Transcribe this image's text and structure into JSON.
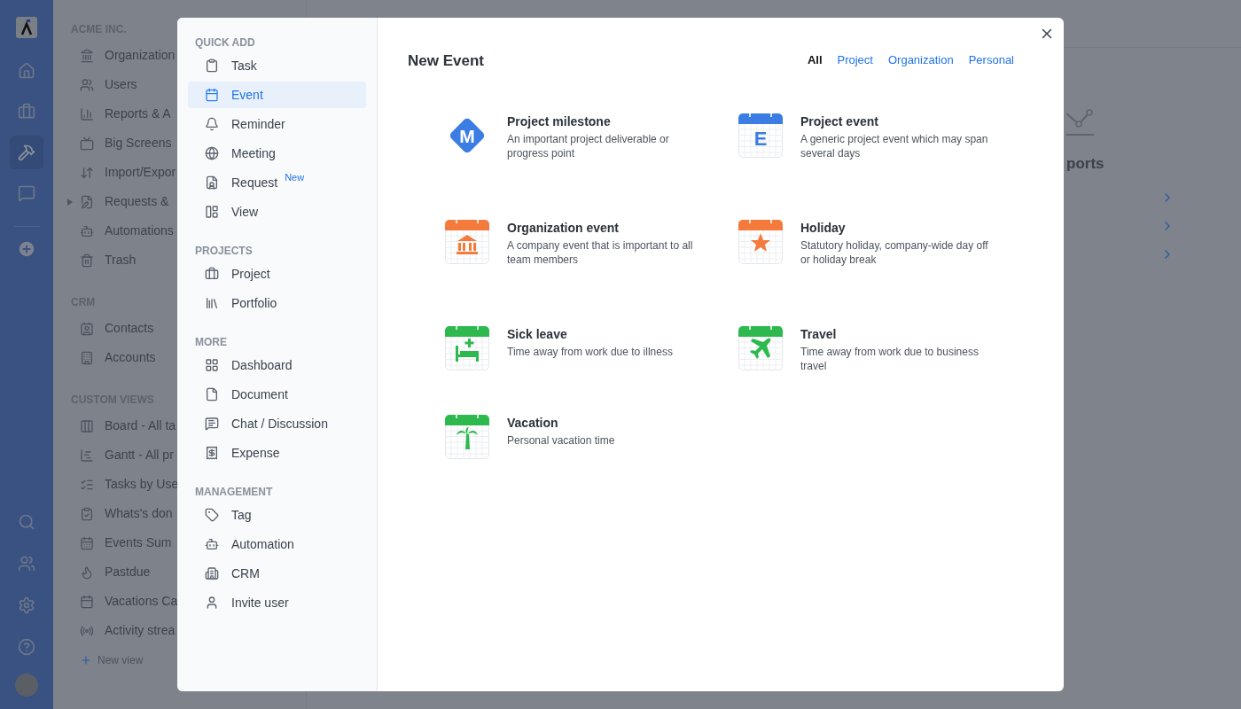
{
  "rail": {
    "items": [
      {
        "selected": false
      },
      {
        "selected": false
      },
      {
        "selected": true
      },
      {
        "selected": false
      }
    ]
  },
  "sidebar": {
    "sections": [
      {
        "title": "ACME INC.",
        "items": [
          {
            "label": "Organization",
            "expandable": false
          },
          {
            "label": "Users",
            "expandable": false
          },
          {
            "label": "Reports & A",
            "expandable": false
          },
          {
            "label": "Big Screens",
            "expandable": false
          },
          {
            "label": "Import/Expor",
            "expandable": false
          },
          {
            "label": "Requests &",
            "expandable": true
          },
          {
            "label": "Automations",
            "expandable": false
          },
          {
            "label": "Trash",
            "expandable": false
          }
        ]
      },
      {
        "title": "CRM",
        "items": [
          {
            "label": "Contacts",
            "expandable": false
          },
          {
            "label": "Accounts",
            "expandable": false
          }
        ]
      },
      {
        "title": "CUSTOM VIEWS",
        "items": [
          {
            "label": "Board - All ta",
            "expandable": false
          },
          {
            "label": "Gantt - All pr",
            "expandable": false
          },
          {
            "label": "Tasks by Use",
            "expandable": false
          },
          {
            "label": "Whats's don",
            "expandable": false
          },
          {
            "label": "Events Sum",
            "expandable": false
          },
          {
            "label": "Pastdue",
            "expandable": false
          },
          {
            "label": "Vacations Ca",
            "expandable": false
          },
          {
            "label": "Activity strea",
            "expandable": false
          }
        ]
      }
    ],
    "new_view": "New view"
  },
  "main": {
    "heading": "ports"
  },
  "modal": {
    "menu": [
      {
        "title": "QUICK ADD",
        "items": [
          {
            "label": "Task",
            "selected": false
          },
          {
            "label": "Event",
            "selected": true
          },
          {
            "label": "Reminder",
            "selected": false
          },
          {
            "label": "Meeting",
            "selected": false
          },
          {
            "label": "Request",
            "selected": false,
            "badge": "New"
          },
          {
            "label": "View",
            "selected": false
          }
        ]
      },
      {
        "title": "PROJECTS",
        "items": [
          {
            "label": "Project",
            "selected": false
          },
          {
            "label": "Portfolio",
            "selected": false
          }
        ]
      },
      {
        "title": "MORE",
        "items": [
          {
            "label": "Dashboard",
            "selected": false
          },
          {
            "label": "Document",
            "selected": false
          },
          {
            "label": "Chat / Discussion",
            "selected": false
          },
          {
            "label": "Expense",
            "selected": false
          }
        ]
      },
      {
        "title": "MANAGEMENT",
        "items": [
          {
            "label": "Tag",
            "selected": false
          },
          {
            "label": "Automation",
            "selected": false
          },
          {
            "label": "CRM",
            "selected": false
          },
          {
            "label": "Invite user",
            "selected": false
          }
        ]
      }
    ],
    "title": "New Event",
    "filters": [
      {
        "label": "All",
        "selected": true
      },
      {
        "label": "Project",
        "selected": false
      },
      {
        "label": "Organization",
        "selected": false
      },
      {
        "label": "Personal",
        "selected": false
      }
    ],
    "event_types": [
      {
        "title": "Project milestone",
        "description": "An important project deliverable or progress point",
        "kind": "diamond",
        "color": "#3b7de3",
        "letter": "M"
      },
      {
        "title": "Project event",
        "description": "A generic project event which may span several days",
        "kind": "letter",
        "color": "#3b7de3",
        "letter": "E"
      },
      {
        "title": "Organization event",
        "description": "A company event that is important to all team members",
        "kind": "building",
        "color": "#f47b3c"
      },
      {
        "title": "Holiday",
        "description": "Statutory holiday, company-wide day off or holiday break",
        "kind": "star",
        "color": "#f47b3c"
      },
      {
        "title": "Sick leave",
        "description": "Time away from work due to illness",
        "kind": "bed",
        "color": "#2eb94f"
      },
      {
        "title": "Travel",
        "description": "Time away from work due to business travel",
        "kind": "plane",
        "color": "#2eb94f"
      },
      {
        "title": "Vacation",
        "description": "Personal vacation time",
        "kind": "palm",
        "color": "#2eb94f"
      }
    ]
  }
}
